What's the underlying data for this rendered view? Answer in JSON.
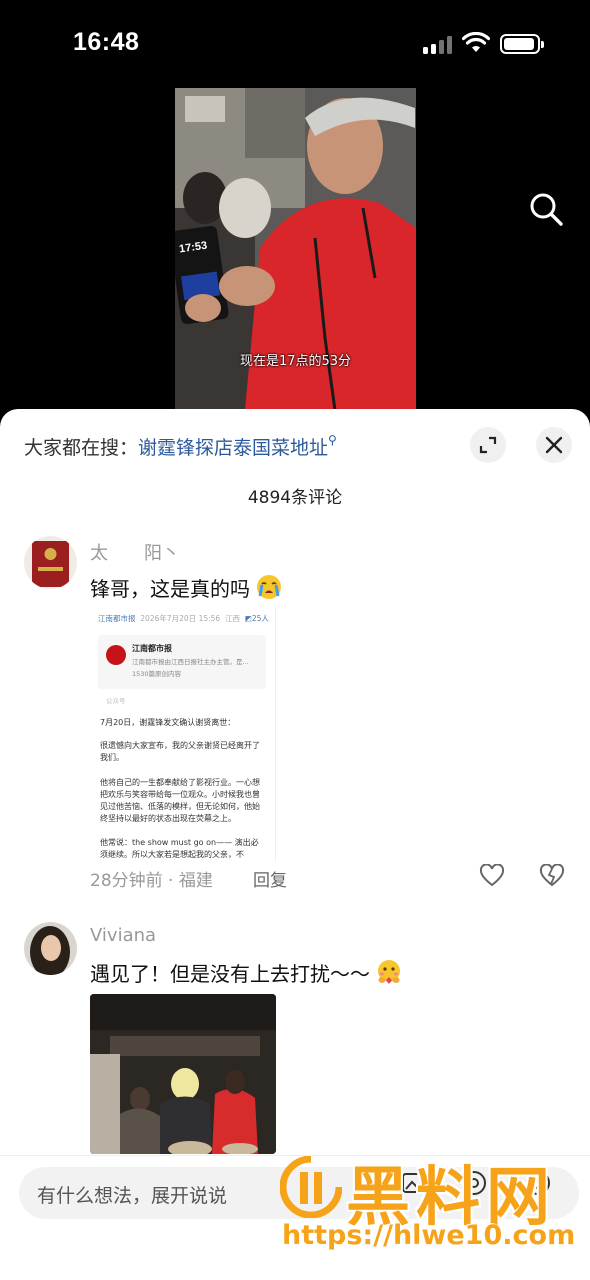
{
  "status_bar": {
    "time": "16:48"
  },
  "video": {
    "caption": "现在是17点的53分",
    "phone_time": "17:53"
  },
  "sheet": {
    "hot_search_prefix": "大家都在搜：",
    "hot_search_term": "谢霆锋探店泰国菜地址",
    "comment_count": "4894条评论"
  },
  "comments": [
    {
      "username": "太　　阳丶",
      "text": "锋哥，这是真的吗",
      "emoji": "crying-face",
      "time_location": "28分钟前 · 福建",
      "reply_label": "回复",
      "screenshot": {
        "source": "江南都市报",
        "date": "2026年7月20日 15:56",
        "region": "江西",
        "people": "25人",
        "account_name": "江南都市报",
        "account_desc": "江南都市报由江西日报社主办主管。是...",
        "account_count": "1530篇原创内容",
        "account_type": "公众号",
        "paragraphs": [
          "7月20日，谢霆锋发文确认谢贤离世：",
          "很遗憾向大家宣布，我的父亲谢贤已经离开了我们。",
          "他将自己的一生都奉献给了影视行业。一心想把欢乐与笑容带给每一位观众。小时候我也曾见过他苦恼、低落的模样，但无论如何，他始终坚持以最好的状态出现在荧幕之上。",
          "他常说：the show must go on—— 演出必须继续。所以大家若是想起我的父亲，不"
        ]
      }
    },
    {
      "username": "Viviana",
      "text": "遇见了！但是没有上去打扰～～",
      "emoji": "hugging-face"
    }
  ],
  "input": {
    "placeholder": "有什么想法，展开说说"
  },
  "watermark": {
    "text": "黑料网",
    "url": "https://hlwe10.com"
  }
}
